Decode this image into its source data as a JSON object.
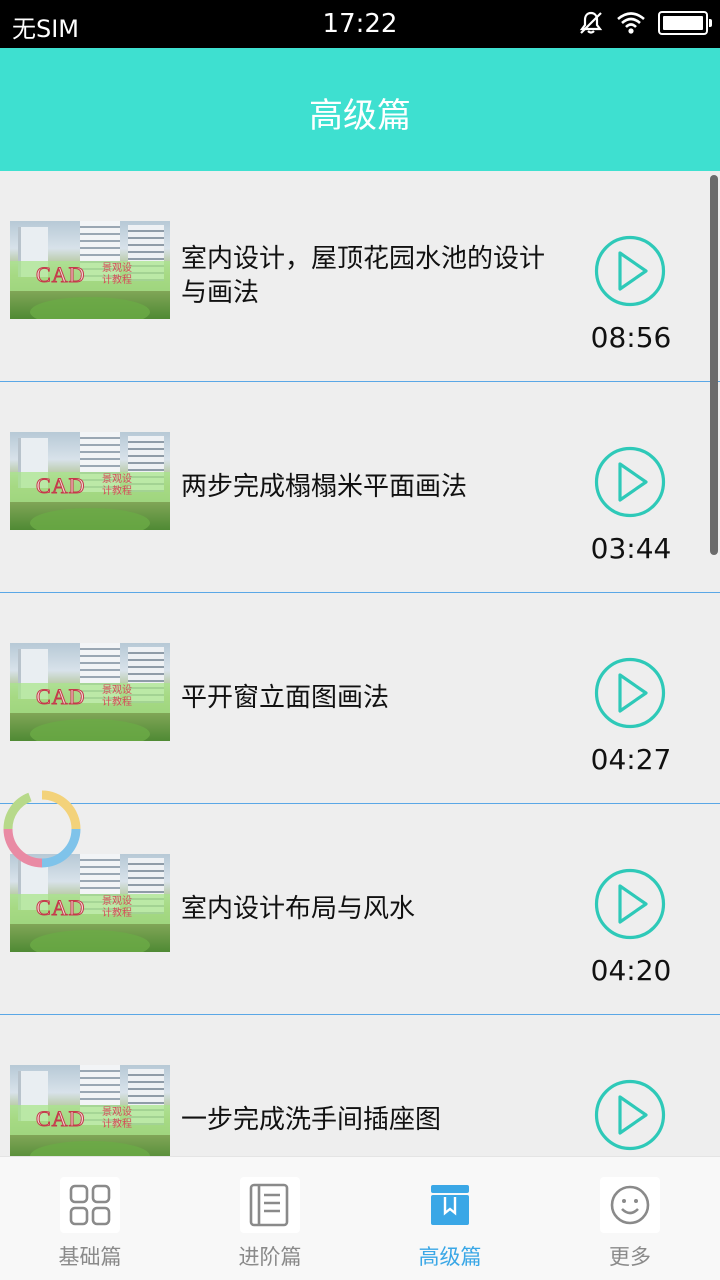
{
  "status_bar": {
    "carrier": "无SIM",
    "time": "17:22",
    "icons": [
      "mute-icon",
      "wifi-icon",
      "battery-icon"
    ]
  },
  "header": {
    "title": "高级篇"
  },
  "videos": [
    {
      "title": "室内设计，屋顶花园水池的设计与画法",
      "duration": "08:56",
      "thumb_text": "CAD"
    },
    {
      "title": "两步完成榻榻米平面画法",
      "duration": "03:44",
      "thumb_text": "CAD"
    },
    {
      "title": "平开窗立面图画法",
      "duration": "04:27",
      "thumb_text": "CAD"
    },
    {
      "title": "室内设计布局与风水",
      "duration": "04:20",
      "thumb_text": "CAD"
    },
    {
      "title": "一步完成洗手间插座图",
      "duration": "",
      "thumb_text": "CAD"
    }
  ],
  "bottom_nav": {
    "items": [
      {
        "label": "基础篇",
        "icon": "grid-icon",
        "active": false
      },
      {
        "label": "进阶篇",
        "icon": "book-icon",
        "active": false
      },
      {
        "label": "高级篇",
        "icon": "bookmark-book-icon",
        "active": true
      },
      {
        "label": "更多",
        "icon": "smile-icon",
        "active": false
      }
    ]
  },
  "colors": {
    "header_bg": "#3ee0d0",
    "accent_teal": "#2ec9b8",
    "active_tab": "#3aa7e6",
    "divider": "#5aa7e6"
  }
}
